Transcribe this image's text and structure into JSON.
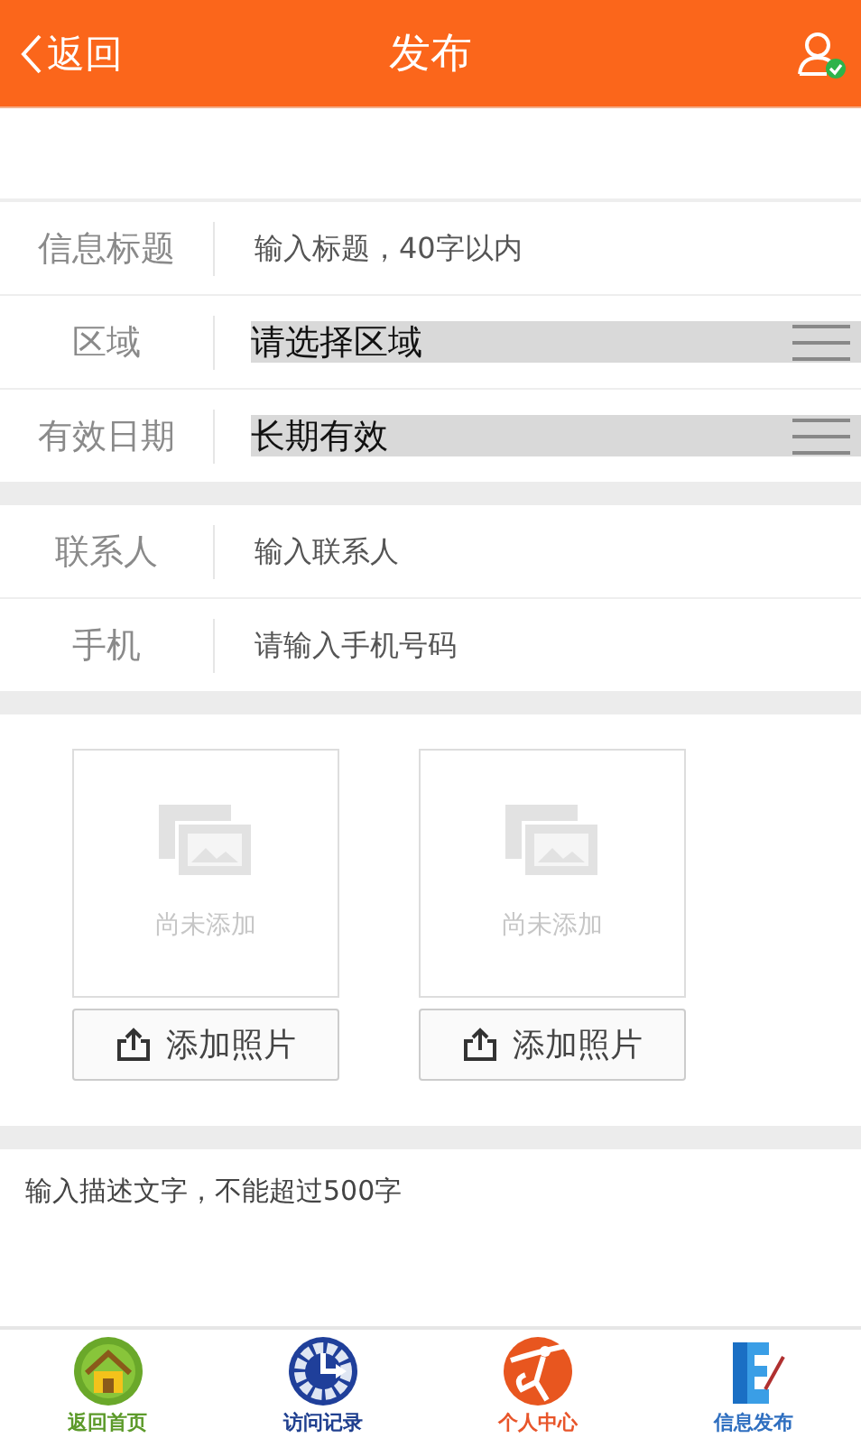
{
  "header": {
    "back": "返回",
    "title": "发布"
  },
  "groups": [
    {
      "fields": [
        {
          "kind": "input",
          "label": "信息标题",
          "placeholder": "输入标题，40字以内"
        },
        {
          "kind": "select",
          "label": "区域",
          "value": "请选择区域"
        },
        {
          "kind": "select",
          "label": "有效日期",
          "value": "长期有效"
        }
      ]
    },
    {
      "fields": [
        {
          "kind": "input",
          "label": "联系人",
          "placeholder": "输入联系人"
        },
        {
          "kind": "input",
          "label": "手机",
          "placeholder": "请输入手机号码"
        }
      ]
    }
  ],
  "photos": [
    {
      "empty_text": "尚未添加",
      "button": "添加照片"
    },
    {
      "empty_text": "尚未添加",
      "button": "添加照片"
    }
  ],
  "description": {
    "placeholder": "输入描述文字，不能超过500字"
  },
  "nav": [
    {
      "kind": "home",
      "label": "返回首页",
      "color": "#5c9a2a"
    },
    {
      "kind": "history",
      "label": "访问记录",
      "color": "#1f3f8f"
    },
    {
      "kind": "person",
      "label": "个人中心",
      "color": "#e8552a"
    },
    {
      "kind": "publish",
      "label": "信息发布",
      "color": "#2f6fc0"
    }
  ]
}
